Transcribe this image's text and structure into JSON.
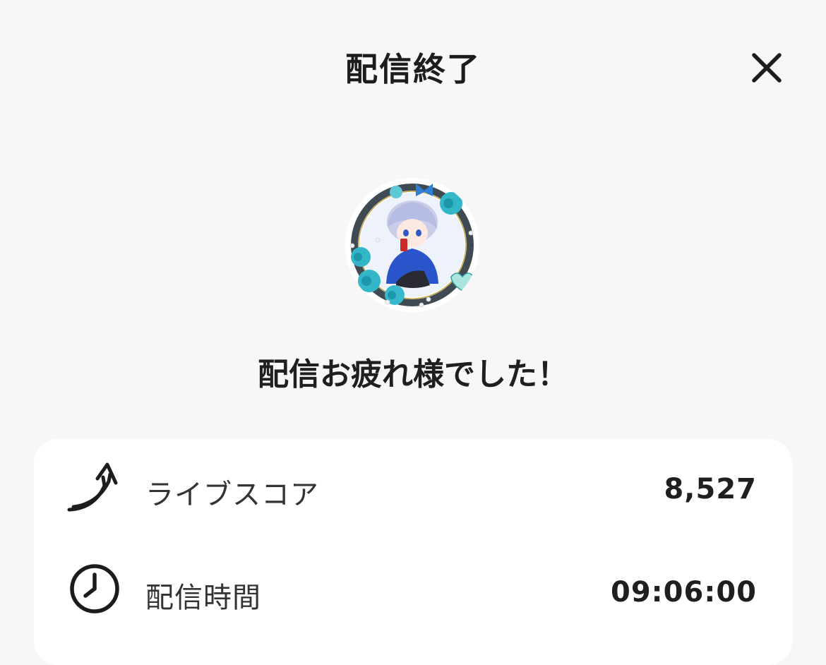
{
  "header": {
    "title": "配信終了",
    "close_icon": "close-icon"
  },
  "profile": {
    "avatar_description": "avatar"
  },
  "greeting": "配信お疲れ様でした！",
  "stats": [
    {
      "icon": "live-score-arrow-icon",
      "label": "ライブスコア",
      "value": "8,527"
    },
    {
      "icon": "clock-icon",
      "label": "配信時間",
      "value": "09:06:00"
    }
  ],
  "colors": {
    "background": "#f7f7f7",
    "card": "#ffffff",
    "text": "#222222",
    "accent_teal": "#2fb4c8",
    "accent_blue": "#2a54c9"
  }
}
